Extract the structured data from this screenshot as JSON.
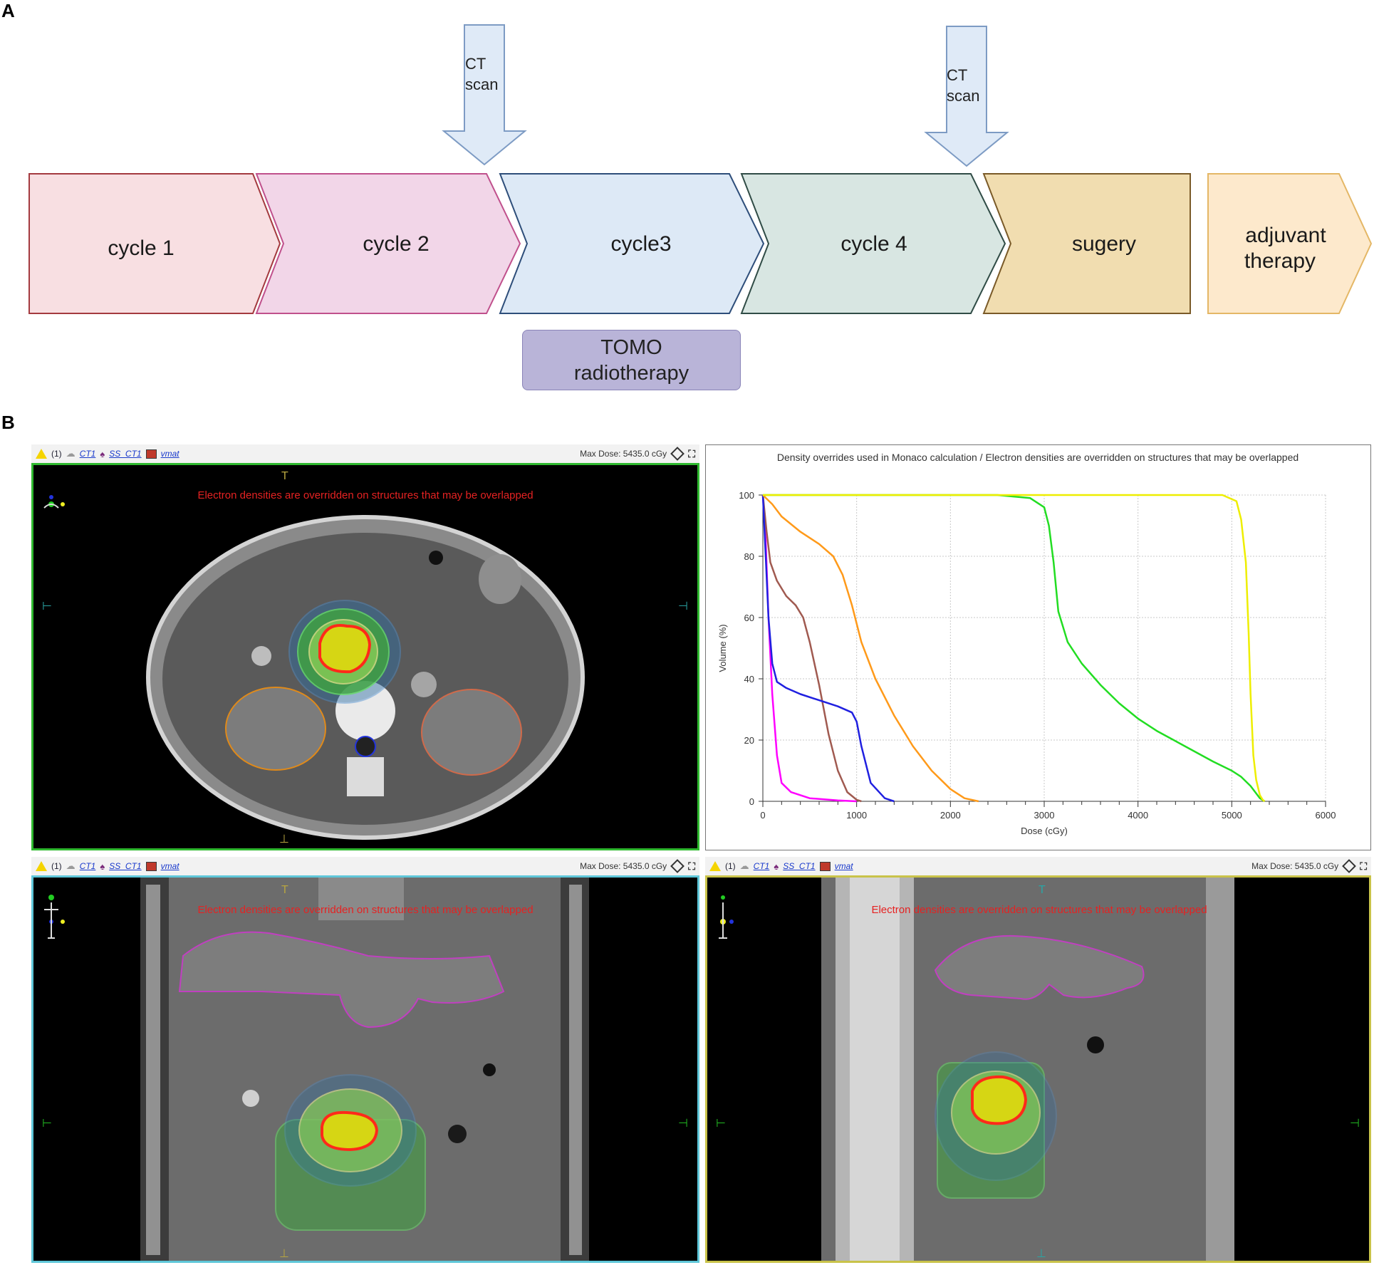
{
  "panel_a": {
    "letter": "A"
  },
  "panel_b": {
    "letter": "B"
  },
  "timeline": {
    "steps": [
      {
        "label": "cycle 1",
        "fill": "#f8dfe2",
        "stroke": "#a43a3f"
      },
      {
        "label": "cycle 2",
        "fill": "#f2d6e8",
        "stroke": "#c0508c"
      },
      {
        "label": "cycle3",
        "fill": "#dde9f6",
        "stroke": "#2e4e7a"
      },
      {
        "label": "cycle 4",
        "fill": "#d8e6e2",
        "stroke": "#304c46"
      },
      {
        "label": "sugery",
        "fill": "#f1ddb0",
        "stroke": "#7a5a28"
      },
      {
        "label_line1": "adjuvant",
        "label_line2": "therapy",
        "fill": "#fde9cc",
        "stroke": "#e4b766"
      }
    ],
    "ct_arrows": [
      {
        "line1": "CT",
        "line2": "scan"
      },
      {
        "line1": "CT",
        "line2": "scan"
      }
    ],
    "tomo": {
      "line1": "TOMO",
      "line2": "radiotherapy"
    }
  },
  "toolbar": {
    "count": "(1)",
    "ct": "CT1",
    "ss": "SS_CT1",
    "plan": "vmat",
    "max_dose": "Max Dose: 5435.0 cGy"
  },
  "views": {
    "warning": "Electron densities are overridden on structures that may be overlapped",
    "top_marker": "T",
    "bottom_marker": "⊥"
  },
  "colors": {
    "axial_border": "#2fb82f",
    "coronal_border": "#5fc7d9",
    "sagittal_border": "#c9c34a"
  },
  "chart_data": {
    "type": "line",
    "title": "Density overrides used in Monaco calculation / Electron densities are overridden on structures that may be overlapped",
    "xlabel": "Dose (cGy)",
    "ylabel": "Volume (%)",
    "xlim": [
      0,
      6000
    ],
    "ylim": [
      0,
      100
    ],
    "xticks": [
      0,
      1000,
      2000,
      3000,
      4000,
      5000,
      6000
    ],
    "yticks": [
      0,
      20,
      40,
      60,
      80,
      100
    ],
    "grid": true,
    "series": [
      {
        "color": "#ff00ff",
        "x": [
          0,
          30,
          60,
          100,
          150,
          200,
          300,
          500,
          800,
          1000
        ],
        "y": [
          100,
          85,
          60,
          35,
          15,
          6,
          3,
          1,
          0.3,
          0
        ]
      },
      {
        "color": "#a05a50",
        "x": [
          0,
          40,
          80,
          150,
          250,
          350,
          430,
          500,
          600,
          700,
          800,
          900,
          1000,
          1050
        ],
        "y": [
          100,
          88,
          78,
          72,
          67,
          64,
          60,
          52,
          38,
          22,
          10,
          3,
          0.5,
          0
        ]
      },
      {
        "color": "#2020e0",
        "x": [
          0,
          30,
          60,
          100,
          150,
          250,
          400,
          600,
          800,
          950,
          1000,
          1050,
          1150,
          1300,
          1400
        ],
        "y": [
          100,
          80,
          60,
          45,
          39,
          37,
          35,
          33,
          31,
          29,
          26,
          18,
          6,
          1,
          0
        ]
      },
      {
        "color": "#ff9a1a",
        "x": [
          0,
          100,
          200,
          400,
          600,
          750,
          850,
          950,
          1050,
          1200,
          1400,
          1600,
          1800,
          2000,
          2150,
          2300
        ],
        "y": [
          100,
          97,
          93,
          88,
          84,
          80,
          74,
          64,
          52,
          40,
          28,
          18,
          10,
          4,
          1,
          0
        ]
      },
      {
        "color": "#22dd22",
        "x": [
          0,
          2500,
          2850,
          3000,
          3050,
          3100,
          3150,
          3250,
          3400,
          3600,
          3800,
          4000,
          4200,
          4500,
          4800,
          5000,
          5100,
          5200,
          5300,
          5350
        ],
        "y": [
          100,
          100,
          99,
          96,
          90,
          78,
          62,
          52,
          45,
          38,
          32,
          27,
          23,
          18,
          13,
          10,
          8,
          5,
          1,
          0
        ]
      },
      {
        "color": "#eeee00",
        "x": [
          0,
          4900,
          5050,
          5100,
          5150,
          5180,
          5200,
          5230,
          5260,
          5300,
          5330,
          5350
        ],
        "y": [
          100,
          100,
          98,
          92,
          78,
          55,
          35,
          15,
          7,
          2,
          0.5,
          0
        ]
      }
    ]
  }
}
